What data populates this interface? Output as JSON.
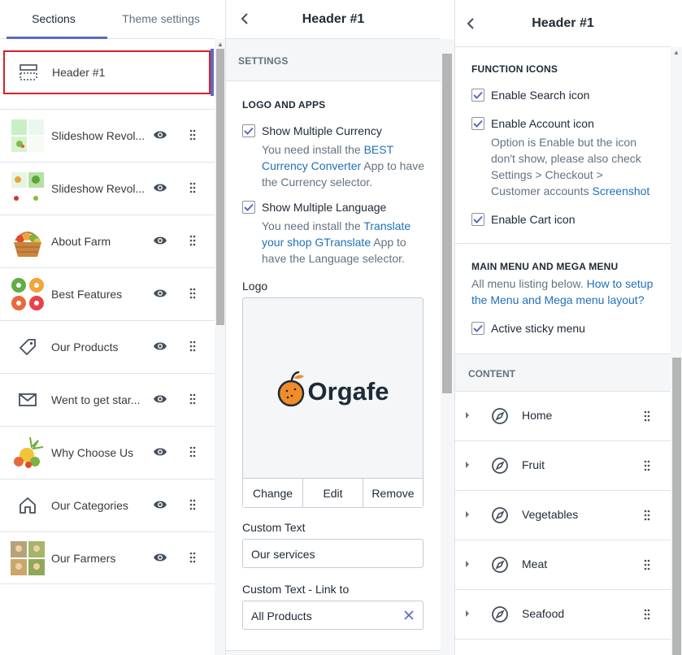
{
  "sidebar": {
    "tabs": [
      {
        "label": "Sections"
      },
      {
        "label": "Theme settings"
      }
    ],
    "header_item": {
      "label": "Header #1"
    },
    "sections": [
      {
        "label": "Slideshow Revol...",
        "thumb": "slideshow-thumbnail"
      },
      {
        "label": "Slideshow Revol...",
        "thumb": "slideshow-thumbnail"
      },
      {
        "label": "About Farm",
        "thumb": "fruit-basket-thumbnail"
      },
      {
        "label": "Best Features",
        "thumb": "features-thumbnail"
      },
      {
        "label": "Our Products",
        "thumb": "tag-icon"
      },
      {
        "label": "Went to get star...",
        "thumb": "mail-icon"
      },
      {
        "label": "Why Choose Us",
        "thumb": "fruit-splash-thumbnail"
      },
      {
        "label": "Our Categories",
        "thumb": "home-icon"
      },
      {
        "label": "Our Farmers",
        "thumb": "farmers-thumbnail"
      }
    ]
  },
  "middle": {
    "title": "Header #1",
    "settings_heading": "SETTINGS",
    "logo_apps_heading": "LOGO AND APPS",
    "currency": {
      "label": "Show Multiple Currency",
      "checked": true,
      "help_pre": "You need install the ",
      "help_link": "BEST Currency Converter",
      "help_post": " App to have the Currency selector."
    },
    "language": {
      "label": "Show Multiple Language",
      "checked": true,
      "help_pre": "You need install the ",
      "help_link": "Translate your shop GTranslate",
      "help_post": " App to have the Language selector."
    },
    "logo_label": "Logo",
    "logo_text": "Orgafe",
    "logo_actions": {
      "change": "Change",
      "edit": "Edit",
      "remove": "Remove"
    },
    "custom_text": {
      "label": "Custom Text",
      "value": "Our services"
    },
    "custom_link": {
      "label": "Custom Text - Link to",
      "value": "All Products"
    }
  },
  "right": {
    "title": "Header #1",
    "function_icons_heading": "FUNCTION ICONS",
    "search": {
      "label": "Enable Search icon",
      "checked": true
    },
    "account": {
      "label": "Enable Account icon",
      "checked": true,
      "help_pre": "Option is Enable but the icon don't show, please also check Settings > Checkout > Customer accounts ",
      "help_link": "Screenshot"
    },
    "cart": {
      "label": "Enable Cart icon",
      "checked": true
    },
    "menu_heading": "MAIN MENU AND MEGA MENU",
    "menu_help_pre": "All menu listing below. ",
    "menu_help_link": "How to setup the Menu and Mega menu layout?",
    "sticky": {
      "label": "Active sticky menu",
      "checked": true
    },
    "content_heading": "CONTENT",
    "menu_items": [
      {
        "label": "Home"
      },
      {
        "label": "Fruit"
      },
      {
        "label": "Vegetables"
      },
      {
        "label": "Meat"
      },
      {
        "label": "Seafood"
      }
    ]
  },
  "colors": {
    "accent": "#5c6ac4",
    "selection": "#d81f26",
    "link": "#1f70b8",
    "logo_orange": "#f28c28",
    "logo_dark": "#1f2a36"
  }
}
